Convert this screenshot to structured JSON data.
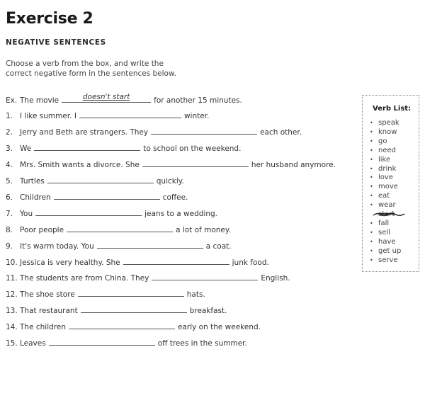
{
  "header": {
    "title": "Exercise 2",
    "subtitle": "NEGATIVE SENTENCES",
    "instructions": "Choose a verb from the box, and write the correct negative form in the sentences below."
  },
  "example": {
    "number": "Ex.",
    "before": "The movie",
    "answer": "doesn't start",
    "after": "for another 15 minutes."
  },
  "sentences": [
    {
      "number": "1.",
      "before": "I like summer. I",
      "after": "winter."
    },
    {
      "number": "2.",
      "before": "Jerry and Beth are strangers. They",
      "after": "each other."
    },
    {
      "number": "3.",
      "before": "We",
      "after": "to school on the weekend."
    },
    {
      "number": "4.",
      "before": "Mrs. Smith wants a divorce. She",
      "after": "her husband anymore."
    },
    {
      "number": "5.",
      "before": "Turtles",
      "after": "quickly."
    },
    {
      "number": "6.",
      "before": "Children",
      "after": "coffee."
    },
    {
      "number": "7.",
      "before": "You",
      "after": "jeans to a wedding."
    },
    {
      "number": "8.",
      "before": "Poor people",
      "after": "a lot of money."
    },
    {
      "number": "9.",
      "before": "It's warm today. You",
      "after": "a coat."
    },
    {
      "number": "10.",
      "before": "Jessica is very healthy. She",
      "after": "junk food."
    },
    {
      "number": "11.",
      "before": "The students are from China. They",
      "after": "English."
    },
    {
      "number": "12.",
      "before": "The shoe store",
      "after": "hats."
    },
    {
      "number": "13.",
      "before": "That restaurant",
      "after": "breakfast."
    },
    {
      "number": "14.",
      "before": "The children",
      "after": "early on the weekend."
    },
    {
      "number": "15.",
      "before": "Leaves",
      "after": "off trees in the summer."
    }
  ],
  "verb_list": {
    "title": "Verb List:",
    "bullet": "•",
    "items": [
      {
        "label": "speak",
        "struck": false
      },
      {
        "label": "know",
        "struck": false
      },
      {
        "label": "go",
        "struck": false
      },
      {
        "label": "need",
        "struck": false
      },
      {
        "label": "like",
        "struck": false
      },
      {
        "label": "drink",
        "struck": false
      },
      {
        "label": "love",
        "struck": false
      },
      {
        "label": "move",
        "struck": false
      },
      {
        "label": "eat",
        "struck": false
      },
      {
        "label": "wear",
        "struck": false
      },
      {
        "label": "start",
        "struck": true
      },
      {
        "label": "fall",
        "struck": false
      },
      {
        "label": "sell",
        "struck": false
      },
      {
        "label": "have",
        "struck": false
      },
      {
        "label": "get up",
        "struck": false
      },
      {
        "label": "serve",
        "struck": false
      }
    ]
  }
}
